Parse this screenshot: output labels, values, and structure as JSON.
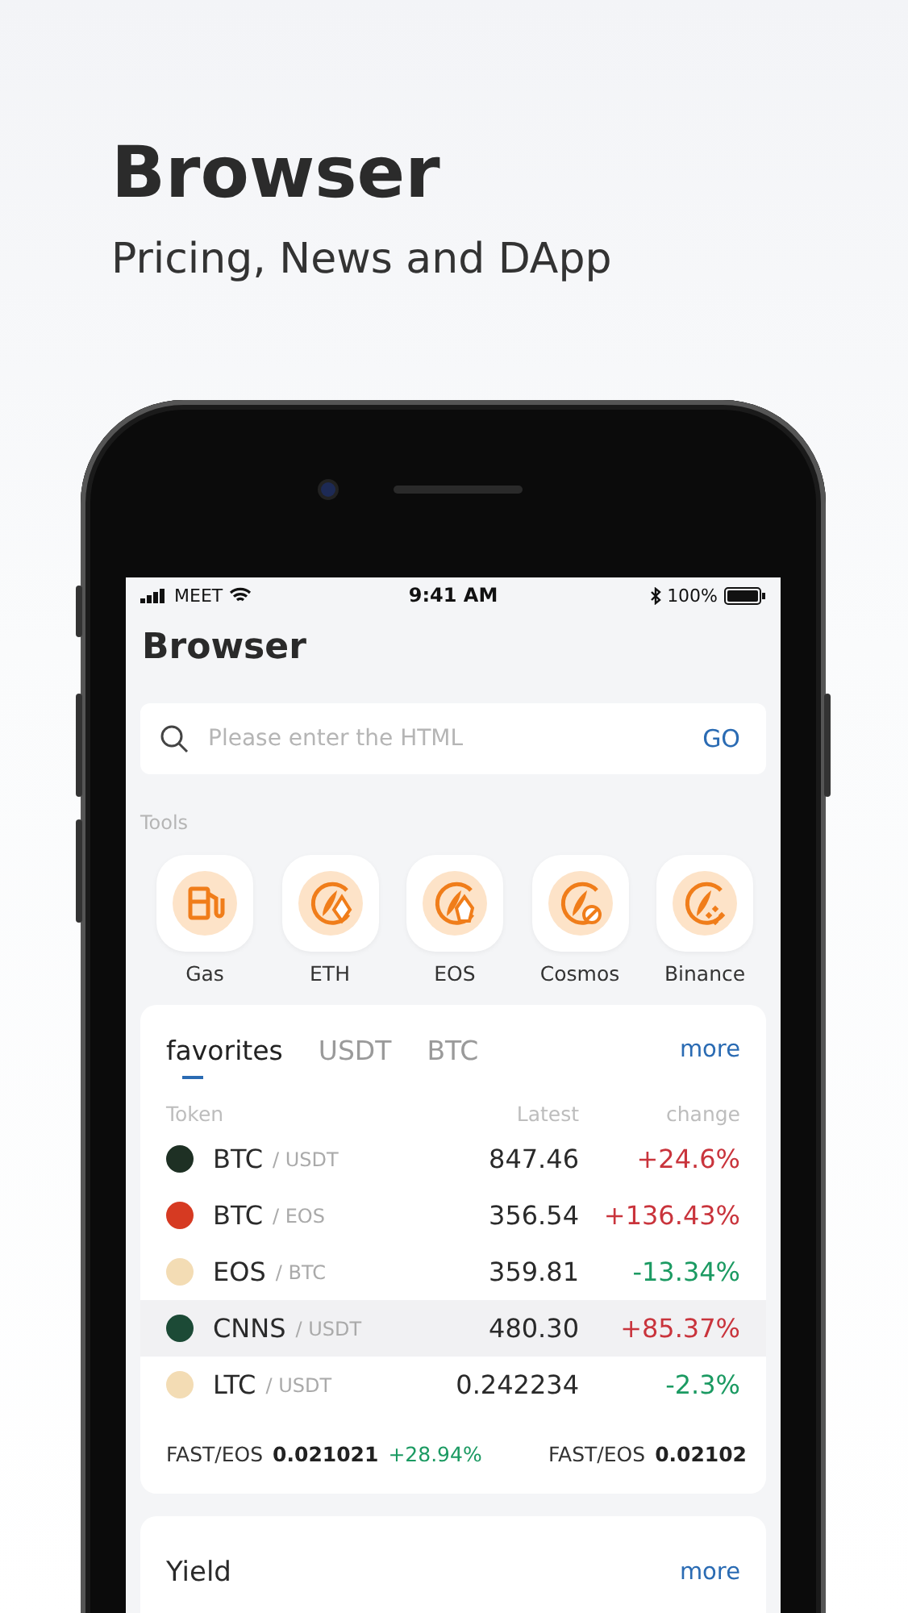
{
  "headline": {
    "title": "Browser",
    "subtitle": "Pricing, News and DApp"
  },
  "status_bar": {
    "carrier": "MEET",
    "time": "9:41 AM",
    "battery": "100%"
  },
  "screen_title": "Browser",
  "search": {
    "placeholder": "Please enter the HTML",
    "button": "GO"
  },
  "tools": {
    "label": "Tools",
    "items": [
      {
        "label": "Gas",
        "kind": "gas"
      },
      {
        "label": "ETH",
        "kind": "eth"
      },
      {
        "label": "EOS",
        "kind": "eos"
      },
      {
        "label": "Cosmos",
        "kind": "cosmos"
      },
      {
        "label": "Binance",
        "kind": "binance"
      }
    ]
  },
  "market": {
    "tabs": [
      {
        "label": "favorites",
        "selected": true
      },
      {
        "label": "USDT",
        "selected": false
      },
      {
        "label": "BTC",
        "selected": false
      }
    ],
    "more": "more",
    "columns": [
      "Token",
      "Latest",
      "change"
    ],
    "rows": [
      {
        "token": "BTC",
        "quote": "/ USDT",
        "latest": "847.46",
        "change": "+24.6%",
        "positive": true,
        "color": "#1e3024",
        "selected": false
      },
      {
        "token": "BTC",
        "quote": "/ EOS",
        "latest": "356.54",
        "change": "+136.43%",
        "positive": true,
        "color": "#d63a22",
        "selected": false
      },
      {
        "token": "EOS",
        "quote": "/ BTC",
        "latest": "359.81",
        "change": "-13.34%",
        "positive": false,
        "color": "#f3dcb4",
        "selected": false
      },
      {
        "token": "CNNS",
        "quote": "/ USDT",
        "latest": "480.30",
        "change": "+85.37%",
        "positive": true,
        "color": "#1c4a36",
        "selected": true
      },
      {
        "token": "LTC",
        "quote": "/ USDT",
        "latest": "0.242234",
        "change": "-2.3%",
        "positive": false,
        "color": "#f3dcb4",
        "selected": false
      }
    ],
    "ticker": [
      {
        "pair": "FAST/EOS",
        "price": "0.021021",
        "change": "+28.94%"
      },
      {
        "pair": "FAST/EOS",
        "price": "0.02102"
      }
    ]
  },
  "yield": {
    "title": "Yield",
    "more": "more"
  }
}
